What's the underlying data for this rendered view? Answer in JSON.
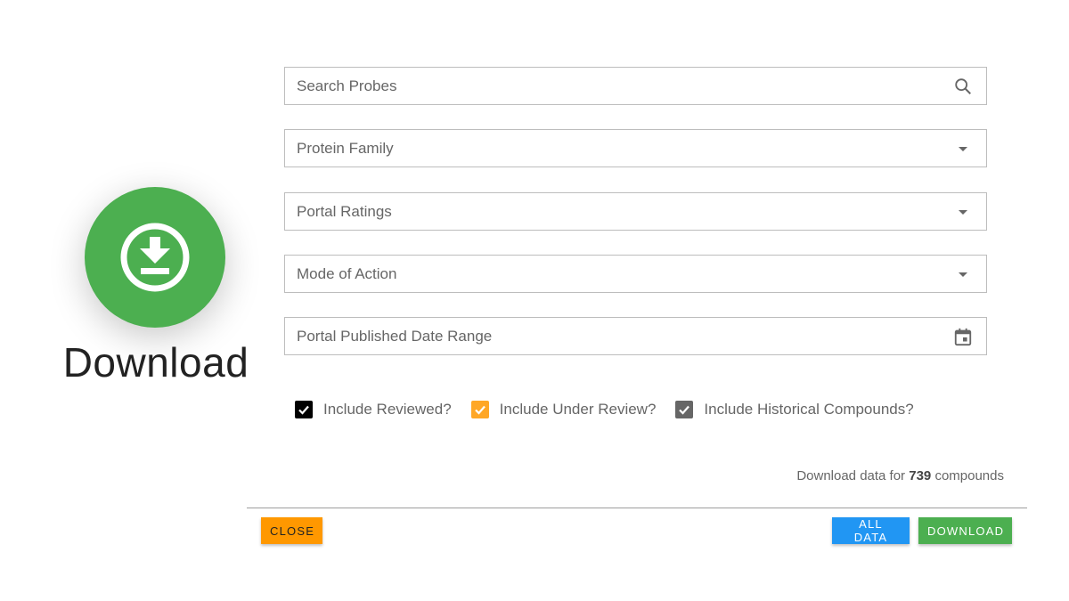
{
  "hero": {
    "icon": "download-circle-icon",
    "label": "Download",
    "color": "#4caf50"
  },
  "filters": {
    "search": {
      "placeholder": "Search Probes",
      "value": "",
      "icon": "search-icon"
    },
    "protein_family": {
      "placeholder": "Protein Family",
      "icon": "dropdown-arrow-icon"
    },
    "portal_ratings": {
      "placeholder": "Portal Ratings",
      "icon": "dropdown-arrow-icon"
    },
    "mode_of_action": {
      "placeholder": "Mode of Action",
      "icon": "dropdown-arrow-icon"
    },
    "date_range": {
      "placeholder": "Portal Published Date Range",
      "icon": "calendar-icon"
    }
  },
  "checkboxes": [
    {
      "label": "Include Reviewed?",
      "checked": true,
      "color": "#000000"
    },
    {
      "label": "Include Under Review?",
      "checked": true,
      "color": "#ffa726"
    },
    {
      "label": "Include Historical Compounds?",
      "checked": true,
      "color": "#666666"
    }
  ],
  "summary": {
    "prefix": "Download data for",
    "count": "739",
    "suffix": "compounds"
  },
  "actions": {
    "close_label": "CLOSE",
    "all_data_label": "ALL DATA",
    "download_label": "DOWNLOAD",
    "close_color": "#ff9800",
    "all_data_color": "#2196f3",
    "download_color": "#4caf50"
  }
}
